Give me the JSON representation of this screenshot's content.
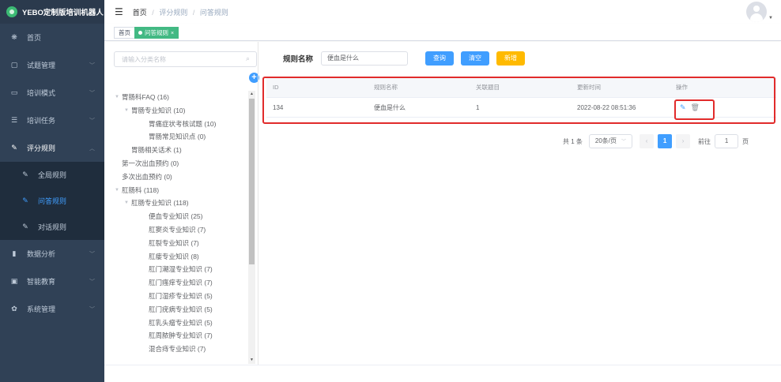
{
  "app": {
    "title": "YEBO定制版培训机器人"
  },
  "sidebar": {
    "items": [
      {
        "label": "首页",
        "icon": "dashboard-icon"
      },
      {
        "label": "试题管理",
        "icon": "monitor-icon"
      },
      {
        "label": "培训模式",
        "icon": "screen-icon"
      },
      {
        "label": "培训任务",
        "icon": "list-icon"
      },
      {
        "label": "评分规则",
        "icon": "edit-icon"
      },
      {
        "label": "数据分析",
        "icon": "chart-icon"
      },
      {
        "label": "智能教育",
        "icon": "education-icon"
      },
      {
        "label": "系统管理",
        "icon": "gear-icon"
      }
    ],
    "submenu": [
      {
        "label": "全局规则",
        "icon": "edit-icon"
      },
      {
        "label": "问答规则",
        "icon": "edit-icon"
      },
      {
        "label": "对话规则",
        "icon": "edit-icon"
      }
    ]
  },
  "header": {
    "breadcrumb": {
      "home": "首页",
      "parent": "评分规则",
      "current": "问答规则",
      "sep": "/"
    }
  },
  "tags": {
    "home": "首页",
    "active": "问答规则"
  },
  "tree": {
    "search_placeholder": "请输入分类名称",
    "nodes": [
      {
        "label": "胃肠科FAQ (16)",
        "level": 0,
        "expanded": true
      },
      {
        "label": "胃肠专业知识 (10)",
        "level": 1,
        "expanded": true
      },
      {
        "label": "胃痛症状考核试题 (10)",
        "level": 2
      },
      {
        "label": "胃肠常见知识点 (0)",
        "level": 2
      },
      {
        "label": "胃肠相关话术 (1)",
        "level": 1
      },
      {
        "label": "第一次出血预约 (0)",
        "level": 0
      },
      {
        "label": "多次出血预约 (0)",
        "level": 0
      },
      {
        "label": "肛肠科 (118)",
        "level": 0,
        "expanded": true
      },
      {
        "label": "肛肠专业知识 (118)",
        "level": 1,
        "expanded": true
      },
      {
        "label": "便血专业知识 (25)",
        "level": 2
      },
      {
        "label": "肛窦炎专业知识 (7)",
        "level": 2
      },
      {
        "label": "肛裂专业知识 (7)",
        "level": 2
      },
      {
        "label": "肛瘘专业知识 (8)",
        "level": 2
      },
      {
        "label": "肛门潮湿专业知识 (7)",
        "level": 2
      },
      {
        "label": "肛门瘙痒专业知识 (7)",
        "level": 2
      },
      {
        "label": "肛门湿疹专业知识 (5)",
        "level": 2
      },
      {
        "label": "肛门疣病专业知识 (5)",
        "level": 2
      },
      {
        "label": "肛乳头瘤专业知识 (5)",
        "level": 2
      },
      {
        "label": "肛周脓肿专业知识 (7)",
        "level": 2
      },
      {
        "label": "混合痔专业知识 (7)",
        "level": 2
      }
    ]
  },
  "filter": {
    "label": "规则名称",
    "value": "便血是什么",
    "buttons": {
      "search": "查询",
      "clear": "清空",
      "add": "新增"
    }
  },
  "table": {
    "headers": [
      "ID",
      "规则名称",
      "关联题目",
      "更新时间",
      "操作"
    ],
    "rows": [
      {
        "id": "134",
        "name": "便血是什么",
        "count": "1",
        "updated": "2022-08-22 08:51:36"
      }
    ]
  },
  "pagination": {
    "total": "共 1 条",
    "page_size": "20条/页",
    "current_page": "1",
    "goto_label": "前往",
    "goto_value": "1",
    "page_suffix": "页"
  },
  "colors": {
    "sidebar_bg": "#304156",
    "active_menu": "#409eff",
    "active_tag": "#42b983",
    "primary": "#409eff",
    "warning": "#ffba00",
    "highlight_box": "#e12b2b"
  }
}
